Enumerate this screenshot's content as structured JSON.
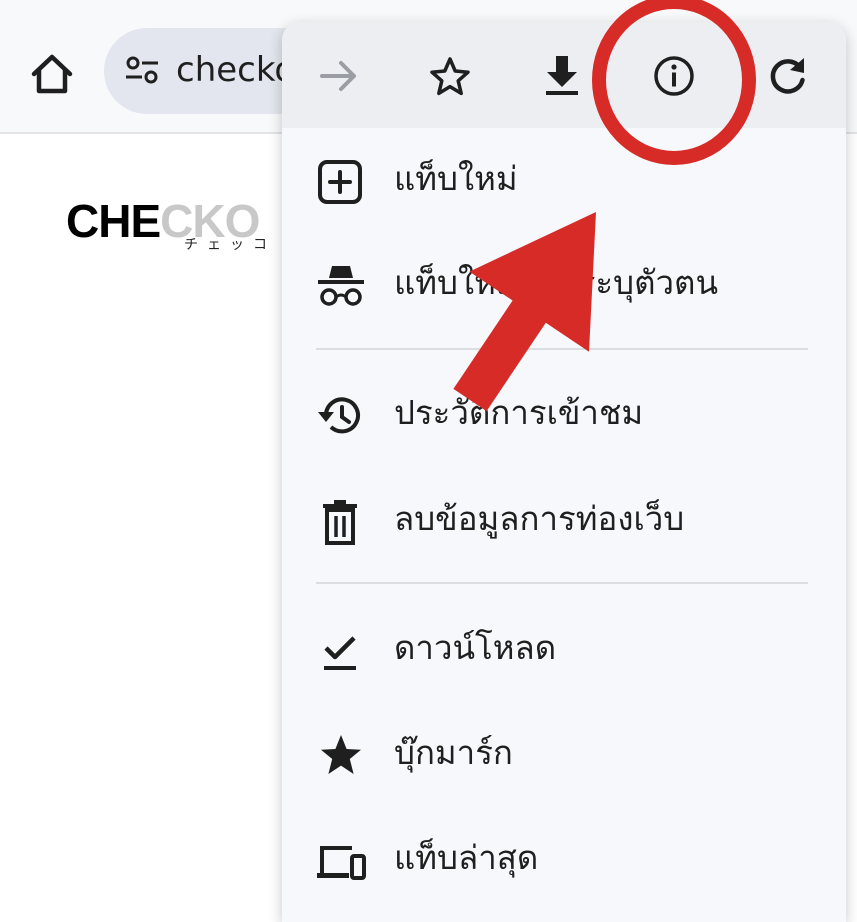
{
  "toolbar": {
    "url_text": "checko",
    "home_icon": "home-icon",
    "site_info_icon": "tune-icon"
  },
  "page": {
    "logo_dark": "CHE",
    "logo_light": "CKO",
    "logo_sub": "チェッコ"
  },
  "menu": {
    "top_row": [
      "forward-icon",
      "star-outline-icon",
      "download-icon",
      "info-icon",
      "reload-icon"
    ],
    "items": [
      {
        "label": "แท็บใหม่",
        "icon": "new-tab-icon"
      },
      {
        "label": "แท็บใหม่ที่ไม่ระบุตัวตน",
        "icon": "incognito-icon"
      },
      {
        "label": "ประวัติการเข้าชม",
        "icon": "history-icon"
      },
      {
        "label": "ลบข้อมูลการท่องเว็บ",
        "icon": "trash-icon"
      },
      {
        "label": "ดาวน์โหลด",
        "icon": "downloads-check-icon"
      },
      {
        "label": "บุ๊กมาร์ก",
        "icon": "star-filled-icon"
      },
      {
        "label": "แท็บล่าสุด",
        "icon": "devices-icon"
      }
    ]
  },
  "colors": {
    "annotation_red": "#d62b27",
    "toolbar_bg": "#f8f9fb",
    "omnibox_bg": "#e3e6ee",
    "menu_bg": "#f7f8fc"
  }
}
